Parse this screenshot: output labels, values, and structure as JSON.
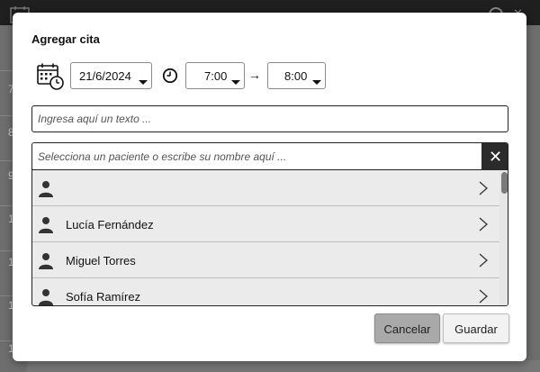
{
  "background": {
    "hours": [
      "7",
      "8",
      "9",
      "10",
      "1",
      "1",
      "1"
    ]
  },
  "dialog": {
    "title": "Agregar cita",
    "date": "21/6/2024",
    "start_time": "7:00",
    "end_time": "8:00",
    "arrow": "→",
    "text_placeholder": "Ingresa aquí un texto ...",
    "patient_placeholder": "Selecciona un paciente o escribe su nombre aquí ...",
    "clear_symbol": "✕",
    "patients": [
      "",
      "Lucía Fernández",
      "Miguel Torres",
      "Sofía Ramírez"
    ],
    "cancel_label": "Cancelar",
    "save_label": "Guardar"
  },
  "colors": {
    "cancel_bg": "#a9a9a9",
    "clear_bg": "#2b2b2b",
    "list_bg": "#ebebeb"
  },
  "icons": {
    "calendar": "calendar-clock-icon",
    "clock": "clock-icon",
    "person": "person-icon",
    "chevron": "chevron-right-icon",
    "clear": "close-icon"
  }
}
